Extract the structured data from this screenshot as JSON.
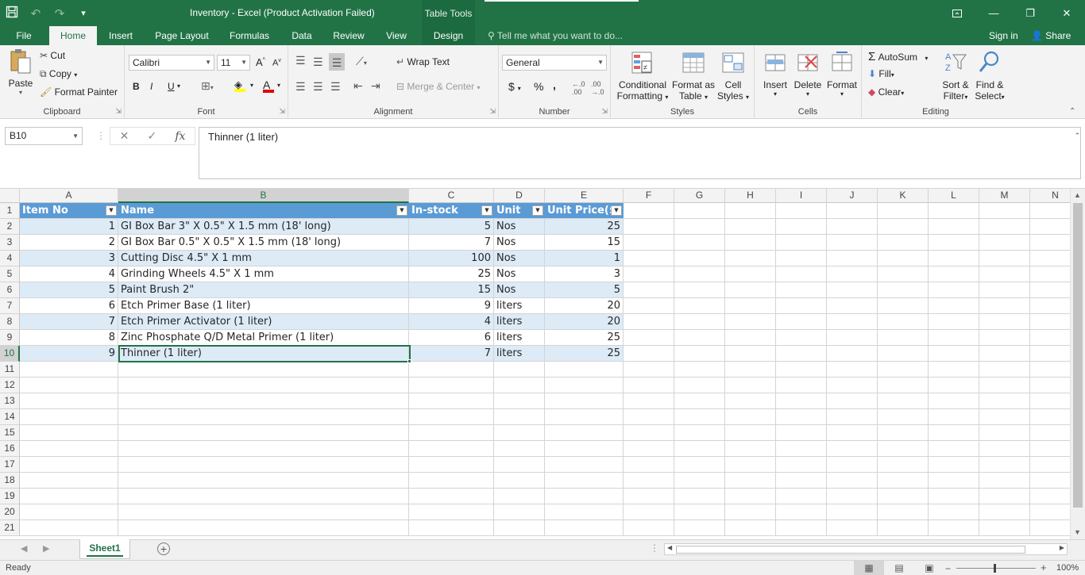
{
  "window": {
    "title": "Inventory - Excel (Product Activation Failed)",
    "context_tab_group": "Table Tools"
  },
  "qat": {
    "save_icon": "save-icon",
    "undo_icon": "undo-icon",
    "redo_icon": "redo-icon",
    "customize_icon": "customize-qat-icon"
  },
  "tabs": [
    {
      "label": "File"
    },
    {
      "label": "Home"
    },
    {
      "label": "Insert"
    },
    {
      "label": "Page Layout"
    },
    {
      "label": "Formulas"
    },
    {
      "label": "Data"
    },
    {
      "label": "Review"
    },
    {
      "label": "View"
    },
    {
      "label": "Design"
    }
  ],
  "tell_me": "Tell me what you want to do...",
  "sign_in": "Sign in",
  "share": "Share",
  "ribbon": {
    "clipboard": {
      "label": "Clipboard",
      "paste": "Paste",
      "cut": "Cut",
      "copy": "Copy",
      "format_painter": "Format Painter"
    },
    "font": {
      "label": "Font",
      "name": "Calibri",
      "size": "11",
      "bold": "B",
      "italic": "I",
      "underline": "U"
    },
    "alignment": {
      "label": "Alignment",
      "wrap_text": "Wrap Text",
      "merge_center": "Merge & Center"
    },
    "number": {
      "label": "Number",
      "format": "General",
      "currency": "$",
      "percent": "%",
      "comma": ","
    },
    "styles": {
      "label": "Styles",
      "conditional_1": "Conditional",
      "conditional_2": "Formatting",
      "format_as_1": "Format as",
      "format_as_2": "Table",
      "cell_styles_1": "Cell",
      "cell_styles_2": "Styles"
    },
    "cells": {
      "label": "Cells",
      "insert": "Insert",
      "delete": "Delete",
      "format": "Format"
    },
    "editing": {
      "label": "Editing",
      "autosum": "AutoSum",
      "fill": "Fill",
      "clear": "Clear",
      "sort_1": "Sort &",
      "sort_2": "Filter",
      "find_1": "Find &",
      "find_2": "Select"
    }
  },
  "formula_bar": {
    "name_box": "B10",
    "fx": "fx",
    "content": "Thinner (1 liter)"
  },
  "columns": [
    "A",
    "B",
    "C",
    "D",
    "E",
    "F",
    "G",
    "H",
    "I",
    "J",
    "K",
    "L",
    "M",
    "N"
  ],
  "rows": [
    "1",
    "2",
    "3",
    "4",
    "5",
    "6",
    "7",
    "8",
    "9",
    "10",
    "11",
    "12",
    "13",
    "14",
    "15",
    "16",
    "17",
    "18",
    "19",
    "20",
    "21"
  ],
  "table": {
    "headers": [
      "Item No",
      "Name",
      "In-stock",
      "Unit",
      "Unit Price($)"
    ],
    "rows": [
      [
        "1",
        "GI Box Bar 3\" X 0.5\" X 1.5 mm (18' long)",
        "5",
        "Nos",
        "25"
      ],
      [
        "2",
        "GI Box Bar 0.5\" X 0.5\" X 1.5 mm (18' long)",
        "7",
        "Nos",
        "15"
      ],
      [
        "3",
        "Cutting Disc 4.5\" X 1 mm",
        "100",
        "Nos",
        "1"
      ],
      [
        "4",
        "Grinding Wheels 4.5\" X 1 mm",
        "25",
        "Nos",
        "3"
      ],
      [
        "5",
        "Paint Brush 2\"",
        "15",
        "Nos",
        "5"
      ],
      [
        "6",
        "Etch Primer Base (1 liter)",
        "9",
        "liters",
        "20"
      ],
      [
        "7",
        "Etch Primer Activator (1 liter)",
        "4",
        "liters",
        "20"
      ],
      [
        "8",
        "Zinc Phosphate Q/D Metal Primer (1 liter)",
        "6",
        "liters",
        "25"
      ],
      [
        "9",
        "Thinner (1 liter)",
        "7",
        "liters",
        "25"
      ]
    ]
  },
  "sheets": [
    {
      "name": "Sheet1"
    }
  ],
  "status": {
    "ready": "Ready",
    "zoom": "100%"
  },
  "colors": {
    "excel_green": "#217346",
    "table_header": "#5b9bd5",
    "table_band": "#ddebf7"
  }
}
